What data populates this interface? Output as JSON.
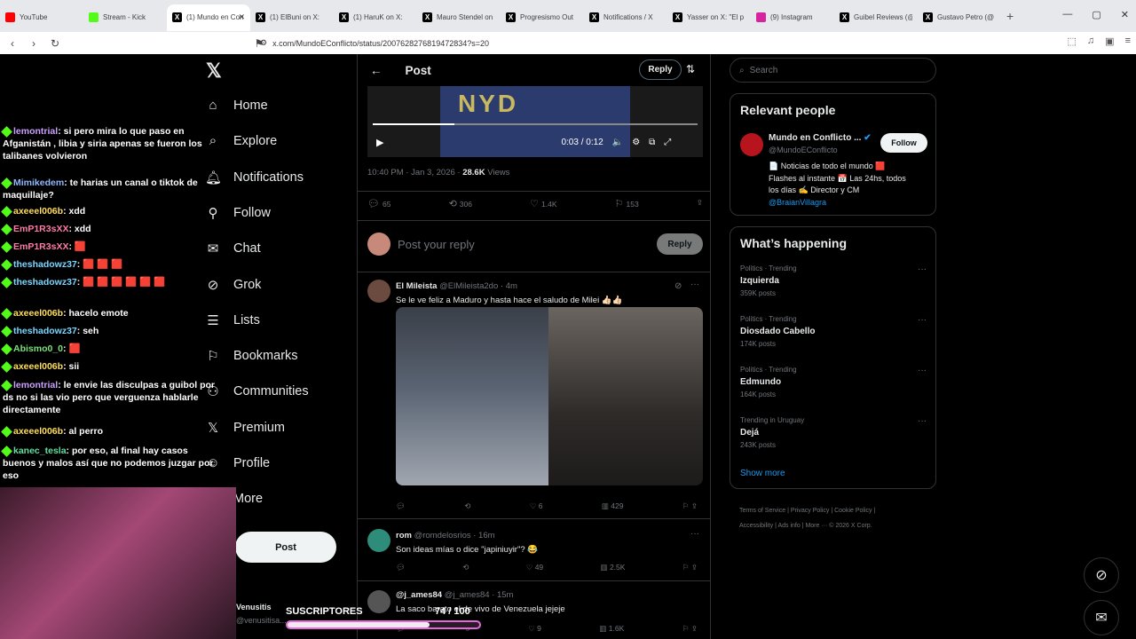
{
  "browser": {
    "tabs": [
      {
        "title": "YouTube",
        "fav": "youtube-icon",
        "color": "#ff0000"
      },
      {
        "title": "Stream - Kick",
        "fav": "kick-icon",
        "color": "#53fc18"
      },
      {
        "title": "(1) Mundo en Con",
        "fav": "x-icon",
        "color": "#000000",
        "active": true
      },
      {
        "title": "(1) ElBuni on X:",
        "fav": "x-icon",
        "color": "#000000"
      },
      {
        "title": "(1) HaruK on X:",
        "fav": "x-icon",
        "color": "#000000"
      },
      {
        "title": "Mauro Stendel on",
        "fav": "x-icon",
        "color": "#000000"
      },
      {
        "title": "Progresismo Out",
        "fav": "x-icon",
        "color": "#000000"
      },
      {
        "title": "Notifications / X",
        "fav": "x-icon",
        "color": "#000000"
      },
      {
        "title": "Yasser on X: \"El p",
        "fav": "x-icon",
        "color": "#000000"
      },
      {
        "title": "(9) Instagram",
        "fav": "instagram-icon",
        "color": "#d6249f"
      },
      {
        "title": "Guibel Reviews (@",
        "fav": "x-icon",
        "color": "#000000"
      },
      {
        "title": "Gustavo Petro (@",
        "fav": "x-icon",
        "color": "#000000"
      }
    ],
    "url": "x.com/MundoEConflicto/status/2007628276819472834?s=20"
  },
  "nav": {
    "items": [
      {
        "label": "Home",
        "icon": "home-icon"
      },
      {
        "label": "Explore",
        "icon": "search-icon"
      },
      {
        "label": "Notifications",
        "icon": "bell-icon"
      },
      {
        "label": "Follow",
        "icon": "follow-icon"
      },
      {
        "label": "Chat",
        "icon": "mail-icon"
      },
      {
        "label": "Grok",
        "icon": "grok-icon"
      },
      {
        "label": "Lists",
        "icon": "list-icon"
      },
      {
        "label": "Bookmarks",
        "icon": "bookmark-icon"
      },
      {
        "label": "Communities",
        "icon": "communities-icon"
      },
      {
        "label": "Premium",
        "icon": "x-premium-icon"
      },
      {
        "label": "Profile",
        "icon": "profile-icon"
      },
      {
        "label": "More",
        "icon": "more-icon"
      }
    ],
    "post_label": "Post",
    "account_name": "Venusitis",
    "account_handle": "@venusitisa..."
  },
  "post": {
    "header": "Post",
    "reply_label": "Reply",
    "video_time": "0:03 / 0:12",
    "time": "10:40 PM · Jan 3, 2026",
    "views": "28.6K",
    "views_label": "Views",
    "replies": "65",
    "reposts": "306",
    "likes": "1.4K",
    "bookmarks": "153",
    "reply_placeholder": "Post your reply",
    "reply_button": "Reply"
  },
  "replies": [
    {
      "name": "El Mileista",
      "handle": "@ElMileista2do · 4m",
      "text": "Se le ve feliz a Maduro y hasta hace el saludo de Milei 👍🏻👍🏻",
      "comments": "",
      "reposts": "",
      "likes": "6",
      "views": "429"
    },
    {
      "name": "rom",
      "handle": "@romdelosrios · 16m",
      "text": "Son ideas mías o dice \"japiniuyir\"? 😂",
      "comments": "",
      "reposts": "",
      "likes": "49",
      "views": "2.5K"
    },
    {
      "name": "@j_ames84",
      "handle": "@j_ames84 · 15m",
      "text": "La saco barato el de vivo de Venezuela jejeje",
      "comments": "",
      "reposts": "",
      "likes": "9",
      "views": "1.6K"
    }
  ],
  "right": {
    "search_placeholder": "Search",
    "relevant_title": "Relevant people",
    "person_name": "Mundo en Conflicto ...",
    "person_handle": "@MundoEConflicto",
    "follow_label": "Follow",
    "bio_1": "📄 Noticias de todo el mundo 🟥",
    "bio_2": "Flashes al instante 📅 Las 24hs, todos",
    "bio_3": "los días ✍️ Director y CM",
    "bio_link": "@BraianVillagra",
    "happening_title": "What’s happening",
    "trends": [
      {
        "context": "Politics · Trending",
        "name": "Izquierda",
        "posts": "359K posts"
      },
      {
        "context": "Politics · Trending",
        "name": "Diosdado Cabello",
        "posts": "174K posts"
      },
      {
        "context": "Politics · Trending",
        "name": "Edmundo",
        "posts": "164K posts"
      },
      {
        "context": "Trending in Uruguay",
        "name": "Dejá",
        "posts": "243K posts"
      }
    ],
    "show_more": "Show more",
    "footer_1": "Terms of Service  |  Privacy Policy  |  Cookie Policy  |",
    "footer_2": "Accessibility  |  Ads info  |  More ···  © 2026 X Corp."
  },
  "chat": [
    {
      "user": "lemontrial",
      "color": "#c9a0ff",
      "text": ": si pero mira lo que paso en Afganistán , libia y siria apenas se fueron los talibanes volvieron"
    },
    {
      "user": "Mimikedem",
      "color": "#8fb8ff",
      "text": ": te harias un canal o tiktok de maquillaje?"
    },
    {
      "user": "axeeel006b",
      "color": "#ffde59",
      "text": ": xdd"
    },
    {
      "user": "EmP1R3sXX",
      "color": "#ff7aa8",
      "text": ": xdd"
    },
    {
      "user": "EmP1R3sXX",
      "color": "#ff7aa8",
      "text": ": 🟥"
    },
    {
      "user": "theshadowz37",
      "color": "#7ad7ff",
      "text": ": 🟥 🟥 🟥"
    },
    {
      "user": "theshadowz37",
      "color": "#7ad7ff",
      "text": ": 🟥 🟥 🟥 🟥 🟥 🟥"
    },
    {
      "user": "axeeel006b",
      "color": "#ffde59",
      "text": ": hacelo emote"
    },
    {
      "user": "theshadowz37",
      "color": "#7ad7ff",
      "text": ": seh"
    },
    {
      "user": "Abismo0_0",
      "color": "#7ae07a",
      "text": ": 🟥"
    },
    {
      "user": "axeeel006b",
      "color": "#ffde59",
      "text": ": sii"
    },
    {
      "user": "lemontrial",
      "color": "#c9a0ff",
      "text": ": le envie las disculpas a guibol por ds no si las vio pero que verguenza hablarle directamente"
    },
    {
      "user": "axeeel006b",
      "color": "#ffde59",
      "text": ": al perro"
    },
    {
      "user": "kanec_tesla",
      "color": "#5fe0a0",
      "text": ": por eso, al final hay casos buenos y malos así que no podemos juzgar por eso"
    }
  ],
  "subs": {
    "label": "SUSCRIPTORES",
    "count": "74 / 100",
    "progress": 0.74
  }
}
